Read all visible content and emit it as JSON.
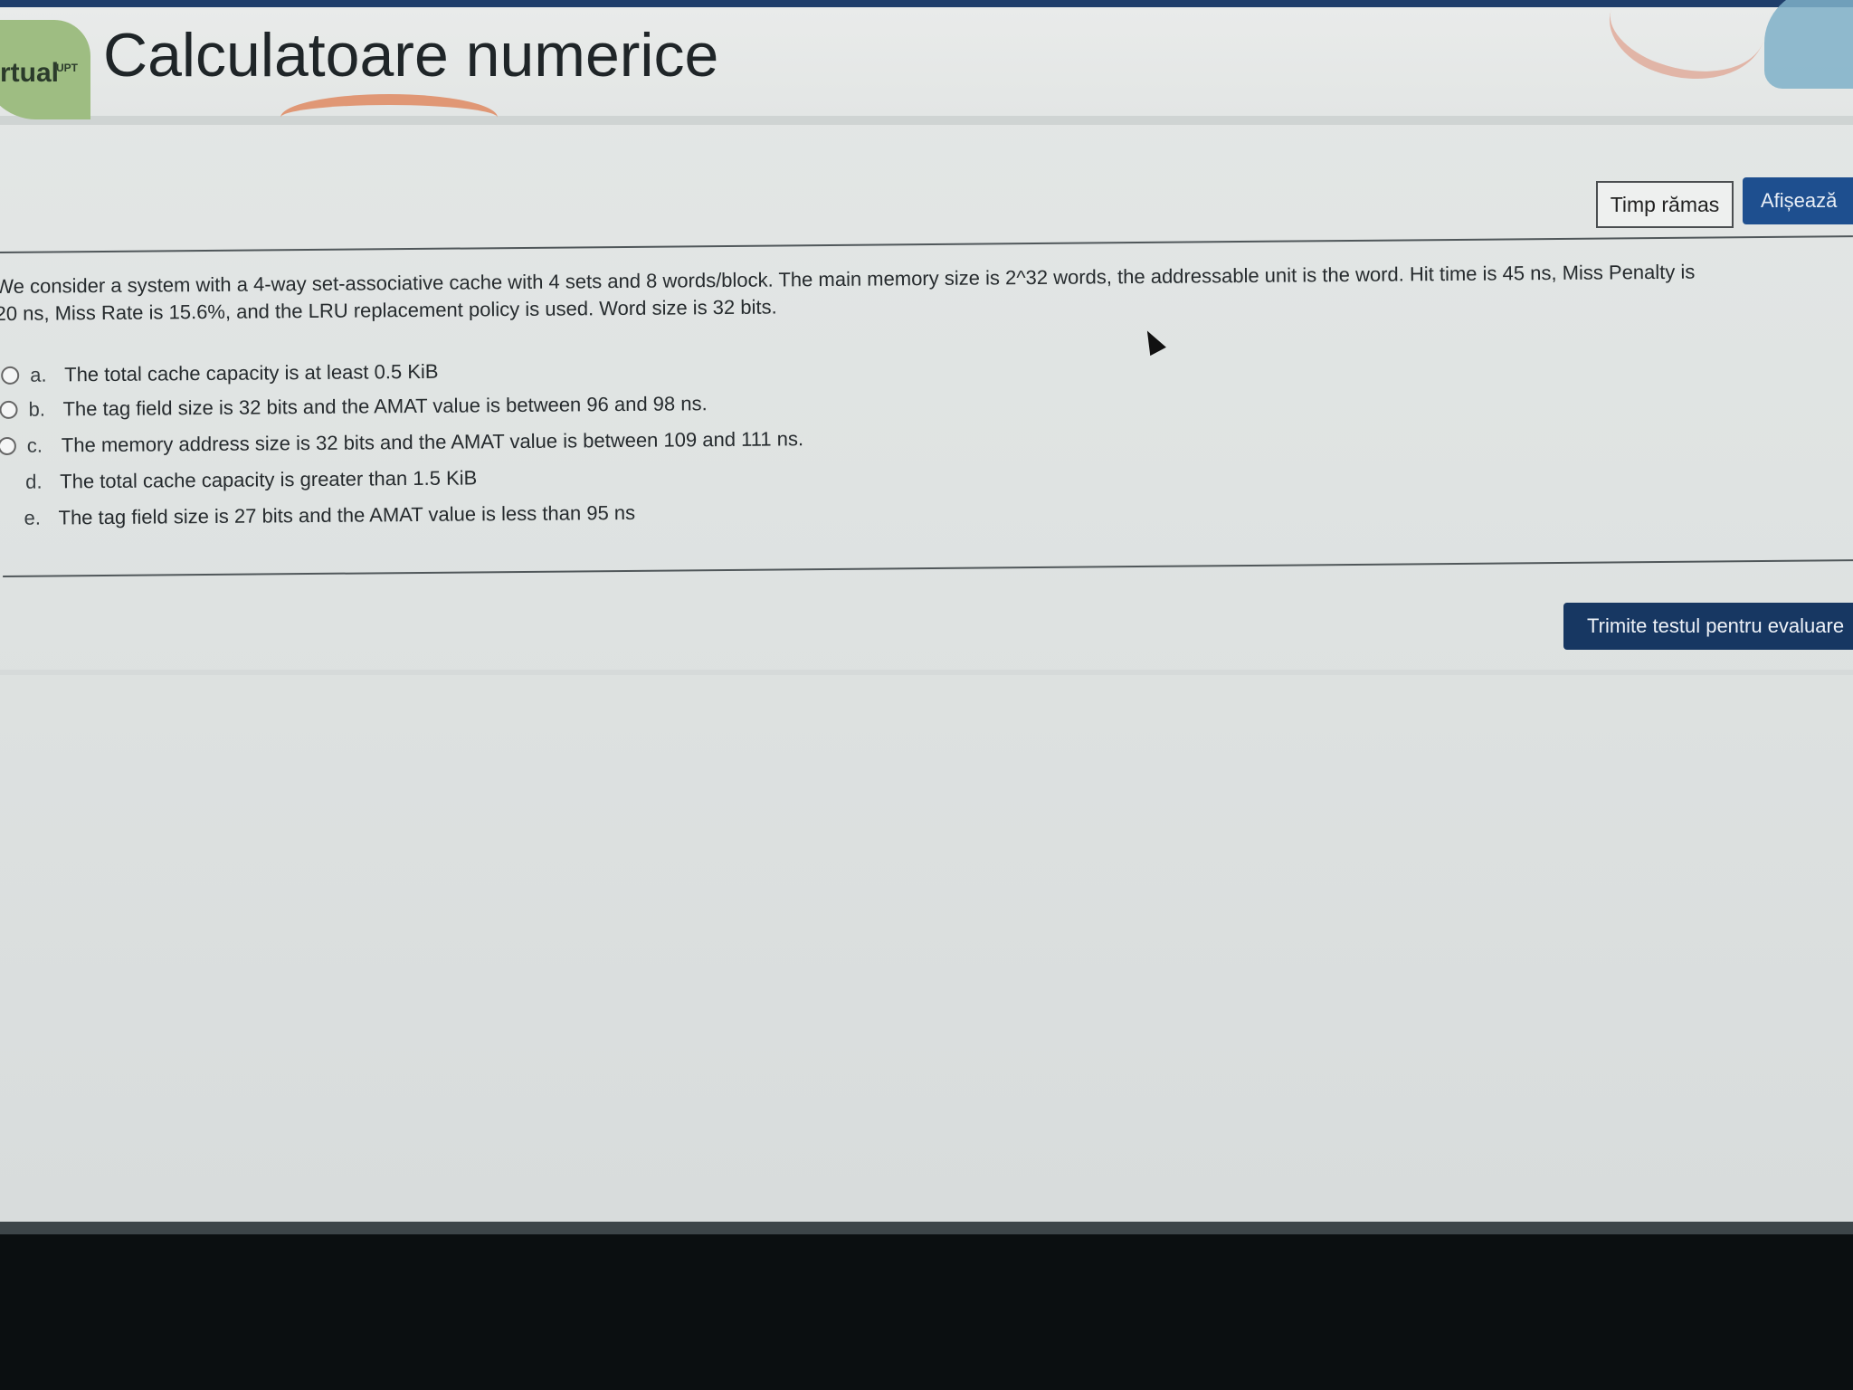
{
  "header": {
    "logo_text": "rtual",
    "logo_superscript": "UPT",
    "course_title": "Calculatoare numerice"
  },
  "timer": {
    "label": "Timp rămas",
    "show_button": "Afișează"
  },
  "question": {
    "text_line1": "We consider a system with a 4-way set-associative cache with 4 sets and 8 words/block. The main memory size is 2^32 words, the addressable unit is the word. Hit time is 45 ns, Miss Penalty is",
    "text_line2": "20 ns, Miss Rate is 15.6%, and the LRU replacement policy is used.  Word size is 32 bits.",
    "options": [
      {
        "letter": "a.",
        "text": "The total cache capacity is at least 0.5 KiB"
      },
      {
        "letter": "b.",
        "text": "The tag field size is 32 bits and the AMAT value is between 96 and 98 ns."
      },
      {
        "letter": "c.",
        "text": "The memory address size is 32 bits and the AMAT value is between 109 and 111 ns."
      },
      {
        "letter": "d.",
        "text": "The total cache capacity is greater than 1.5 KiB"
      },
      {
        "letter": "e.",
        "text": "The tag field size is 27 bits and the AMAT value is less than 95 ns"
      }
    ]
  },
  "footer": {
    "submit_button": "Trimite testul pentru evaluare"
  },
  "colors": {
    "accent_blue": "#1e4f8f",
    "submit_blue": "#173762",
    "logo_green": "#9ebd82"
  }
}
